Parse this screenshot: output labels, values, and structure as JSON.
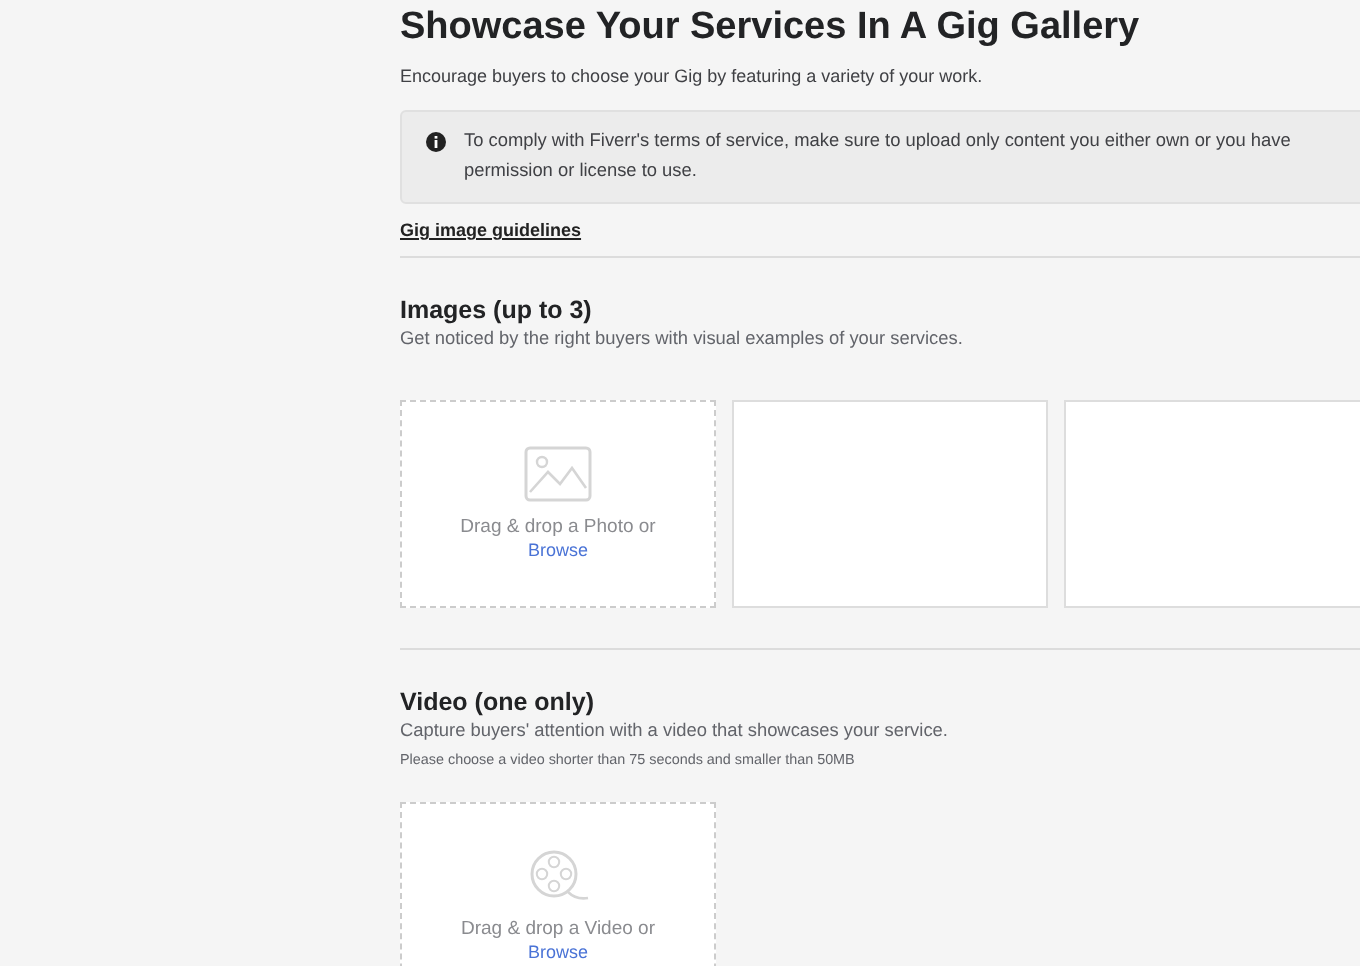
{
  "title": "Showcase Your Services In A Gig Gallery",
  "subtitle": "Encourage buyers to choose your Gig by featuring a variety of your work.",
  "notice": {
    "text": "To comply with Fiverr's terms of service, make sure to upload only content you either own or you have permission or license to use."
  },
  "guidelines_link": "Gig image guidelines",
  "sections": [
    {
      "heading": "Images (up to 3)",
      "description": "Get noticed by the right buyers with visual examples of your services.",
      "slots": [
        {
          "kind": "photo",
          "text": "Drag & drop a Photo or",
          "link": "Browse"
        },
        {
          "kind": "empty"
        },
        {
          "kind": "empty"
        }
      ]
    },
    {
      "heading": "Video (one only)",
      "description": "Capture buyers' attention with a video that showcases your service.",
      "note": "Please choose a video shorter than 75 seconds and smaller than 50MB",
      "slots": [
        {
          "kind": "video",
          "text": "Drag & drop a Video or",
          "link": "Browse"
        }
      ]
    }
  ]
}
